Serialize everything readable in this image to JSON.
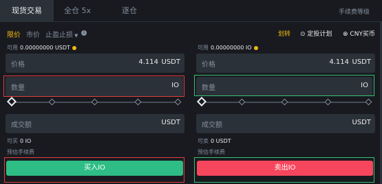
{
  "tabs": {
    "spot": "现货交易",
    "cross": "全仓 5x",
    "isolated": "逐仓"
  },
  "fee_link": "手续费等级",
  "order_types": {
    "limit": "限价",
    "market": "市价",
    "stop": "止盈止损"
  },
  "tools": {
    "transfer": "划转",
    "dca": "定投计划",
    "cny": "CNY买币"
  },
  "buy_panel": {
    "available_label": "可用",
    "available_value": "0.00000000 USDT",
    "price_label": "价格",
    "price_value": "4.114",
    "price_unit": "USDT",
    "qty_label": "数量",
    "qty_unit": "IO",
    "total_label": "成交额",
    "total_unit": "USDT",
    "can_buy_label": "可买",
    "can_buy_value": "0 IO",
    "fee_label": "预估手续费",
    "button": "买入IO"
  },
  "sell_panel": {
    "available_label": "可用",
    "available_value": "0.00000000 IO",
    "price_label": "价格",
    "price_value": "4.114",
    "price_unit": "USDT",
    "qty_label": "数量",
    "qty_unit": "IO",
    "total_label": "成交额",
    "total_unit": "USDT",
    "can_sell_label": "可卖",
    "can_sell_value": "0 USDT",
    "fee_label": "预估手续费",
    "button": "卖出IO"
  }
}
